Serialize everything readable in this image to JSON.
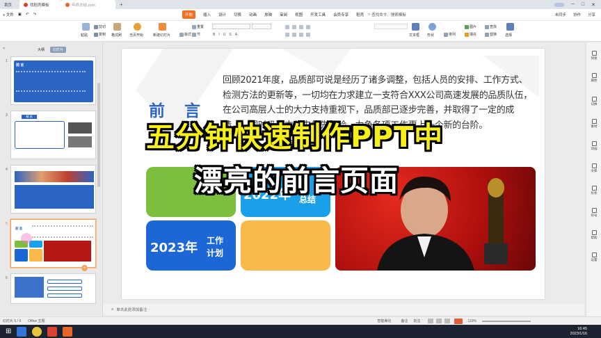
{
  "tabs": {
    "home": "首页",
    "tab1": "找稻壳模板",
    "tab2": "年终总结.pptx",
    "plus": "+"
  },
  "menubar": {
    "file": "≡ 文件",
    "items": [
      "开始",
      "插入",
      "设计",
      "切换",
      "动画",
      "放映",
      "审阅",
      "视图",
      "开发工具",
      "会员专享",
      "稻壳"
    ],
    "search": "查找命令、搜索模板",
    "right": [
      "未同步",
      "协作",
      "分享"
    ]
  },
  "ribbon": {
    "paste": "粘贴",
    "cut": "剪切",
    "copy": "复制",
    "format_painter": "格式刷",
    "play": "当页开始",
    "new_slide": "新建幻灯片",
    "layout": "版式",
    "section": "节",
    "reset": "重置",
    "textbox": "文本框",
    "shape": "形状",
    "arrange": "排列",
    "picture": "图片",
    "fill": "填充",
    "outline": "轮廓",
    "find": "查找",
    "replace": "替换",
    "select": "选择"
  },
  "sidebar": {
    "tab_outline": "大纲",
    "tab_slides": "幻灯片",
    "slides": [
      {
        "num": "1",
        "title": "前 言"
      },
      {
        "num": "3",
        "title": "精 选"
      },
      {
        "num": "4",
        "title": ""
      },
      {
        "num": "5",
        "title": "前 言"
      },
      {
        "num": "6",
        "title": ""
      }
    ]
  },
  "slide": {
    "heading": "前 言",
    "paragraph": "回顾2021年度，品质部可说是经历了诸多调整，包括人员的安排、工作方式、检测方法的更新等，一切均在力求建立一支符合XXX公司高速发展的品质队伍，在公司高层人士的大力支持重视下，品质部已逐步完善，并取得了一定的成绩……同时吸取本年中优先经验，力争各项工作更上一个新的台阶。",
    "block_2022": "2022年",
    "block_summary": "总结",
    "block_2023": "2023年",
    "block_plan_1": "工作",
    "block_plan_2": "计划",
    "colors": {
      "green": "#7cbf3e",
      "blue": "#1aa0e8",
      "darkblue": "#1d66d6",
      "orange": "#f9b94a"
    }
  },
  "overlay": {
    "line1": "五分钟快速制作PPT中",
    "line2": "漂亮的前言页面"
  },
  "right_panel": [
    "快速",
    "属性",
    "切换",
    "素材",
    "动画",
    "文库",
    "形状",
    "符号",
    "帮助",
    "设置"
  ],
  "notes": "单击此处添加备注",
  "status": {
    "slide_info": "幻灯片 5 / 9",
    "theme": "Office 主题",
    "smart": "智能美化",
    "remark": "备注",
    "comment": "批注",
    "zoom": "110%"
  },
  "taskbar": {
    "time": "16:45",
    "date": "2023/1/16"
  }
}
